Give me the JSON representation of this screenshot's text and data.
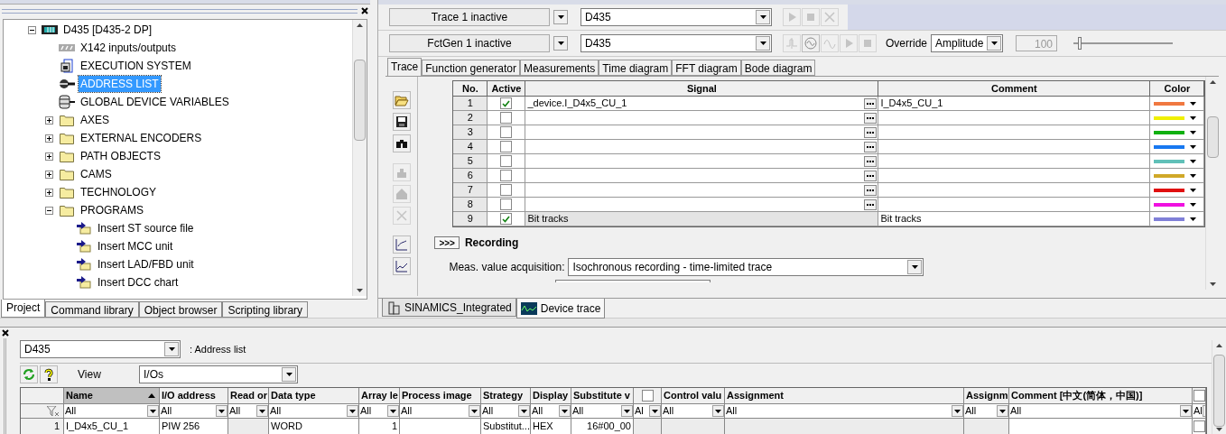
{
  "project_panel": {
    "tree": [
      {
        "label": "D435 [D435-2 DP]",
        "kind": "device",
        "selected": false,
        "expanded": true,
        "children": [
          {
            "label": "X142 inputs/outputs",
            "kind": "io",
            "selected": false
          },
          {
            "label": "EXECUTION SYSTEM",
            "kind": "execution",
            "selected": false
          },
          {
            "label": "ADDRESS LIST",
            "kind": "address",
            "selected": true
          },
          {
            "label": "GLOBAL DEVICE VARIABLES",
            "kind": "variables",
            "selected": false
          },
          {
            "label": "AXES",
            "kind": "folder",
            "selected": false,
            "expanded": false
          },
          {
            "label": "EXTERNAL ENCODERS",
            "kind": "folder",
            "selected": false,
            "expanded": false
          },
          {
            "label": "PATH OBJECTS",
            "kind": "folder",
            "selected": false,
            "expanded": false
          },
          {
            "label": "CAMS",
            "kind": "folder",
            "selected": false,
            "expanded": false
          },
          {
            "label": "TECHNOLOGY",
            "kind": "folder",
            "selected": false,
            "expanded": false
          },
          {
            "label": "PROGRAMS",
            "kind": "folder",
            "selected": false,
            "expanded": true,
            "children": [
              {
                "label": "Insert ST source file",
                "kind": "insert",
                "selected": false
              },
              {
                "label": "Insert MCC unit",
                "kind": "insert",
                "selected": false
              },
              {
                "label": "Insert LAD/FBD unit",
                "kind": "insert",
                "selected": false
              },
              {
                "label": "Insert DCC chart",
                "kind": "insert",
                "selected": false
              }
            ]
          }
        ]
      }
    ],
    "tabs": [
      {
        "label": "Project",
        "selected": true
      },
      {
        "label": "Command library",
        "selected": false
      },
      {
        "label": "Object browser",
        "selected": false
      },
      {
        "label": "Scripting library",
        "selected": false
      }
    ]
  },
  "trace_panel": {
    "trace_row": {
      "status": "Trace 1 inactive",
      "device": "D435"
    },
    "fctgen_row": {
      "status": "FctGen 1 inactive",
      "device": "D435",
      "override_label": "Override",
      "override_value": "Amplitude",
      "value": "100",
      "level": 0.05
    },
    "tabs": [
      {
        "label": "Trace",
        "selected": true
      },
      {
        "label": "Function generator",
        "selected": false
      },
      {
        "label": "Measurements",
        "selected": false
      },
      {
        "label": "Time diagram",
        "selected": false
      },
      {
        "label": "FFT diagram",
        "selected": false
      },
      {
        "label": "Bode diagram",
        "selected": false
      }
    ],
    "table": {
      "columns": [
        "No.",
        "Active",
        "Signal",
        "Comment",
        "Color"
      ],
      "rows": [
        {
          "no": "1",
          "active": true,
          "kind": "signal",
          "signal": "_device.I_D4x5_CU_1",
          "comment": "I_D4x5_CU_1",
          "color": "#f07840"
        },
        {
          "no": "2",
          "active": false,
          "kind": "signal",
          "color": "#f0f000"
        },
        {
          "no": "3",
          "active": false,
          "kind": "signal",
          "color": "#10b010"
        },
        {
          "no": "4",
          "active": false,
          "kind": "signal",
          "color": "#1878f0"
        },
        {
          "no": "5",
          "active": false,
          "kind": "signal",
          "color": "#60c0b8"
        },
        {
          "no": "6",
          "active": false,
          "kind": "signal",
          "color": "#d0a828"
        },
        {
          "no": "7",
          "active": false,
          "kind": "signal",
          "color": "#e01010"
        },
        {
          "no": "8",
          "active": false,
          "kind": "signal",
          "color": "#f010e0"
        },
        {
          "no": "9",
          "active": true,
          "kind": "bit_tracks",
          "signal": "Bit tracks",
          "comment": "Bit tracks",
          "color": "#8080d8"
        }
      ]
    },
    "recording": {
      "expand_button": ">>>",
      "title": "Recording",
      "acquisition_label": "Meas. value acquisition:",
      "acquisition_value": "Isochronous recording - time-limited trace"
    },
    "bottom_tabs": [
      {
        "label": "SINAMICS_Integrated",
        "selected": false
      },
      {
        "label": "Device trace",
        "selected": true
      }
    ]
  },
  "address_list": {
    "device": "D435",
    "title": ": Address list",
    "view_label": "View",
    "view_value": "I/Os",
    "columns": [
      {
        "kind": "text",
        "label": "Name",
        "sorted": true
      },
      {
        "kind": "text",
        "label": "I/O address",
        "sorted": false
      },
      {
        "kind": "text",
        "label": "Read or",
        "sorted": false
      },
      {
        "kind": "text",
        "label": "Data type",
        "sorted": false
      },
      {
        "kind": "text",
        "label": "Array le",
        "sorted": false
      },
      {
        "kind": "text",
        "label": "Process image",
        "sorted": false
      },
      {
        "kind": "text",
        "label": "Strategy",
        "sorted": false
      },
      {
        "kind": "text",
        "label": "Display",
        "sorted": false
      },
      {
        "kind": "text",
        "label": "Substitute v",
        "sorted": false
      },
      {
        "kind": "checkbox",
        "checked": false
      },
      {
        "kind": "text",
        "label": "Control valu",
        "sorted": false
      },
      {
        "kind": "text",
        "label": "Assignment",
        "sorted": false
      },
      {
        "kind": "text",
        "label": "Assignm",
        "sorted": false
      },
      {
        "kind": "text",
        "label": "Comment [中文(简体，中国)]",
        "sorted": false
      },
      {
        "kind": "checkbox",
        "checked": false
      }
    ],
    "filters": [
      "All",
      "All",
      "All",
      "All",
      "All",
      "All",
      "All",
      "All",
      "All",
      "Al",
      "All",
      "All",
      "All",
      "All",
      "Al"
    ],
    "rows": [
      {
        "number": "1",
        "cells": [
          {
            "kind": "text",
            "text": "I_D4x5_CU_1"
          },
          {
            "kind": "text",
            "text": "PIW 256"
          },
          {
            "kind": "empty",
            "shaded": true
          },
          {
            "kind": "text",
            "text": "WORD"
          },
          {
            "kind": "number",
            "text": "1"
          },
          {
            "kind": "empty",
            "shaded": false
          },
          {
            "kind": "text",
            "text": "Substitut..."
          },
          {
            "kind": "text",
            "text": "HEX"
          },
          {
            "kind": "number",
            "text": "16#00_00"
          },
          {
            "kind": "empty",
            "shaded": true
          },
          {
            "kind": "empty",
            "shaded": true
          },
          {
            "kind": "empty",
            "shaded": true
          },
          {
            "kind": "empty",
            "shaded": true
          },
          {
            "kind": "empty",
            "shaded": false
          },
          {
            "kind": "checkbox",
            "checked": false
          }
        ]
      }
    ]
  }
}
